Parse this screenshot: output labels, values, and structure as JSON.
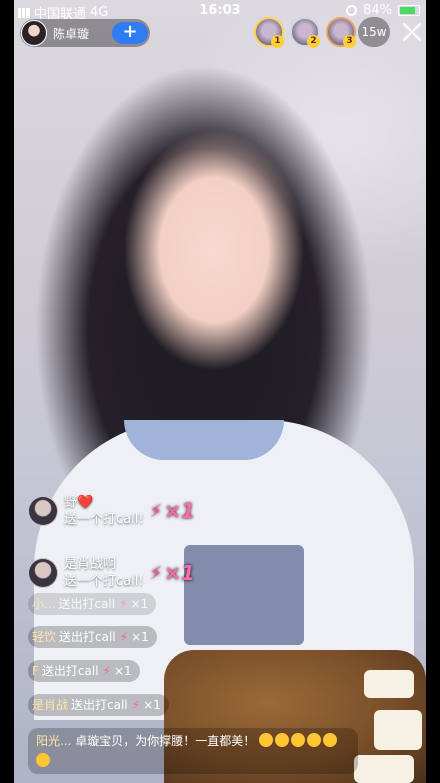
{
  "status_bar": {
    "carrier": "中国联通",
    "network": "4G",
    "time": "16:03",
    "battery": "84%",
    "battery_level": 0.84
  },
  "anchor": {
    "name": "陈卓璇",
    "follow_label": "+"
  },
  "rank": [
    {
      "badge": "1"
    },
    {
      "badge": "2"
    },
    {
      "badge": "3"
    }
  ],
  "viewers": "15w",
  "gift_messages": [
    {
      "user": "野❤️",
      "text": "送一个打call!",
      "multiplier": "×1"
    },
    {
      "user": "是肖战啊",
      "text": "送一个打call!",
      "multiplier": "×1"
    }
  ],
  "chat": [
    {
      "user": "小...",
      "text": "送出打call",
      "count": "×1"
    },
    {
      "user": "轻饮",
      "text": "送出打call",
      "count": "×1"
    },
    {
      "user": "F",
      "text": "送出打call",
      "count": "×1"
    },
    {
      "user": "是肖战",
      "text": "送出打call",
      "count": "×1"
    }
  ],
  "comment": {
    "user": "阳光...",
    "text": "卓璇宝贝，为你撑腰！一直都美！"
  },
  "colors": {
    "accent": "#2f7bf2",
    "gift": "#ff4fa8",
    "username": "#ffe4a8"
  }
}
